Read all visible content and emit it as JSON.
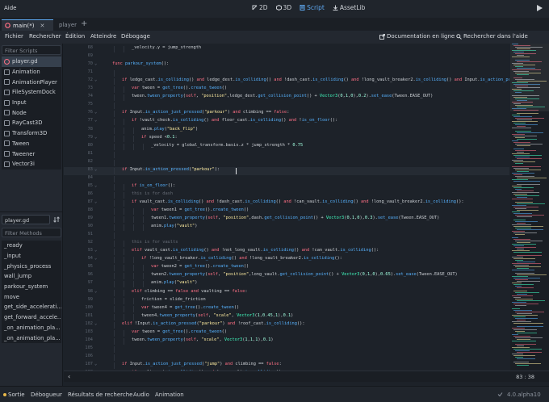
{
  "app": {
    "title": "Aide"
  },
  "modes": [
    {
      "label": "2D"
    },
    {
      "label": "3D"
    },
    {
      "label": "Script",
      "active": true
    },
    {
      "label": "AssetLib"
    }
  ],
  "tabs": {
    "main_label": "main(*)",
    "player_label": "player",
    "add_label": "+"
  },
  "menu": {
    "items": [
      "Fichier",
      "Rechercher",
      "Édition",
      "Atteindre",
      "Débogage"
    ],
    "doc_label": "Documentation en ligne",
    "help_search_label": "Rechercher dans l'aide"
  },
  "left": {
    "filter_scripts_placeholder": "Filter Scripts",
    "scripts": [
      "player.gd",
      "Animation",
      "AnimationPlayer",
      "FileSystemDock",
      "Input",
      "Node",
      "RayCast3D",
      "Transform3D",
      "Tween",
      "Tweener",
      "Vector3i"
    ],
    "current_script": "player.gd",
    "filter_methods_placeholder": "Filter Methods",
    "methods": [
      "_ready",
      "_input",
      "_physics_process",
      "wall_jump",
      "parkour_system",
      "move",
      "get_side_accelerati...",
      "get_forward_accele...",
      "_on_animation_pla...",
      "_on_animation_pla..."
    ]
  },
  "editor": {
    "cursor_line": 83,
    "lines": [
      {
        "n": "68",
        "fold": "",
        "indent": 2,
        "html": "_velocity.y = jump_strength"
      },
      {
        "n": "69",
        "fold": "",
        "indent": 0,
        "html": ""
      },
      {
        "n": "70",
        "fold": "⌄",
        "indent": 0,
        "html": "<span class='k'>func</span> <span class='f'>parkour_system</span>():"
      },
      {
        "n": "71",
        "fold": "",
        "indent": 1,
        "html": ""
      },
      {
        "n": "72",
        "fold": "⌄",
        "indent": 1,
        "html": "<span class='k'>if</span> ledge_cast.<span class='f'>is_colliding</span>() <span class='k'>and</span> ledge_dest.<span class='f'>is_colliding</span>() <span class='k'>and</span> !dash_cast.<span class='f'>is_colliding</span>() <span class='k'>and</span> !long_vault_breaker2.<span class='f'>is_colliding</span>() <span class='k'>and</span> Input.<span class='f'>is_action_pres</span>"
      },
      {
        "n": "73",
        "fold": "",
        "indent": 2,
        "html": "<span class='k'>var</span> tween = <span class='f'>get_tree</span>().<span class='f'>create_tween</span>()"
      },
      {
        "n": "74",
        "fold": "",
        "indent": 2,
        "html": "tween.<span class='f'>tween_property</span>(<span class='k'>self</span>, <span class='s'>\"position\"</span>,ledge_dest.<span class='f'>get_collision_point</span>() + <span class='t'>Vector3</span>(<span class='n'>0</span>,<span class='n'>1</span>,<span class='n'>0</span>),<span class='n'>0.2</span>).<span class='f'>set_ease</span>(Tween.EASE_OUT)"
      },
      {
        "n": "75",
        "fold": "",
        "indent": 1,
        "html": ""
      },
      {
        "n": "76",
        "fold": "⌄",
        "indent": 1,
        "html": "<span class='k'>if</span> Input.<span class='f'>is_action_just_pressed</span>(<span class='s'>\"parkour\"</span>) <span class='k'>and</span> climbing == <span class='k'>false</span>:"
      },
      {
        "n": "77",
        "fold": "⌄",
        "indent": 2,
        "html": "<span class='k'>if</span> !vault_check.<span class='f'>is_colliding</span>() <span class='k'>and</span> floor_cast.<span class='f'>is_colliding</span>() <span class='k'>and</span> !<span class='f'>is_on_floor</span>():"
      },
      {
        "n": "78",
        "fold": "",
        "indent": 3,
        "html": "anim.<span class='f'>play</span>(<span class='s'>\"back_flip\"</span>)"
      },
      {
        "n": "79",
        "fold": "⌄",
        "indent": 3,
        "html": "<span class='k'>if</span> speed &lt;<span class='n'>0.1</span>:"
      },
      {
        "n": "80",
        "fold": "",
        "indent": 4,
        "html": "_velocity = global_transform.basis.z * jump_strength * <span class='n'>0.75</span>"
      },
      {
        "n": "81",
        "fold": "",
        "indent": 1,
        "html": ""
      },
      {
        "n": "82",
        "fold": "",
        "indent": 1,
        "html": ""
      },
      {
        "n": "83",
        "fold": "⌄",
        "indent": 1,
        "html": "<span class='k'>if</span> Input.<span class='f'>is_action_pressed</span>(<span class='s'>\"parkour\"</span>):"
      },
      {
        "n": "84",
        "fold": "",
        "indent": 1,
        "html": ""
      },
      {
        "n": "85",
        "fold": "⌄",
        "indent": 2,
        "html": "<span class='k'>if</span> <span class='f'>is_on_floor</span>():"
      },
      {
        "n": "86",
        "fold": "",
        "indent": 2,
        "html": "<span class='c'>this is for dash</span>"
      },
      {
        "n": "87",
        "fold": "⌄",
        "indent": 2,
        "html": "<span class='k'>if</span> vault_cast.<span class='f'>is_colliding</span>() <span class='k'>and</span> !dash_cast.<span class='f'>is_colliding</span>() <span class='k'>and</span> !can_vault.<span class='f'>is_colliding</span>() <span class='k'>and</span> !long_vault_breaker2.<span class='f'>is_colliding</span>():"
      },
      {
        "n": "88",
        "fold": "",
        "indent": 4,
        "html": "<span class='k'>var</span> tween1 = <span class='f'>get_tree</span>().<span class='f'>create_tween</span>()"
      },
      {
        "n": "89",
        "fold": "",
        "indent": 4,
        "html": "tween1.<span class='f'>tween_property</span>(<span class='k'>self</span>, <span class='s'>\"position\"</span>,dash.<span class='f'>get_collision_point</span>() + <span class='t'>Vector3</span>(<span class='n'>0</span>,<span class='n'>1</span>,<span class='n'>0</span>),<span class='n'>0.3</span>).<span class='f'>set_ease</span>(Tween.EASE_OUT)"
      },
      {
        "n": "90",
        "fold": "",
        "indent": 4,
        "html": "anim.<span class='f'>play</span>(<span class='s'>\"vault\"</span>)"
      },
      {
        "n": "91",
        "fold": "",
        "indent": 1,
        "html": ""
      },
      {
        "n": "92",
        "fold": "",
        "indent": 2,
        "html": "<span class='c'>this is for vaults</span>"
      },
      {
        "n": "93",
        "fold": "⌄",
        "indent": 2,
        "html": "<span class='k'>elif</span> vault_cast.<span class='f'>is_colliding</span>() <span class='k'>and</span> !not_long_vault.<span class='f'>is_colliding</span>() <span class='k'>and</span> !can_vault.<span class='f'>is_colliding</span>():"
      },
      {
        "n": "94",
        "fold": "⌄",
        "indent": 3,
        "html": "<span class='k'>if</span> !long_vault_breaker.<span class='f'>is_colliding</span>() <span class='k'>and</span> !long_vault_breaker2.<span class='f'>is_colliding</span>():"
      },
      {
        "n": "95",
        "fold": "",
        "indent": 4,
        "html": "<span class='k'>var</span> tween2 = <span class='f'>get_tree</span>().<span class='f'>create_tween</span>()"
      },
      {
        "n": "96",
        "fold": "",
        "indent": 4,
        "html": "tween2.<span class='f'>tween_property</span>(<span class='k'>self</span>, <span class='s'>\"position\"</span>,long_vault.<span class='f'>get_collision_point</span>() + <span class='t'>Vector3</span>(<span class='n'>0</span>,<span class='n'>1</span>,<span class='n'>0</span>),<span class='n'>0.65</span>).<span class='f'>set_ease</span>(Tween.EASE_OUT)"
      },
      {
        "n": "97",
        "fold": "",
        "indent": 4,
        "html": "anim.<span class='f'>play</span>(<span class='s'>\"vault\"</span>)"
      },
      {
        "n": "98",
        "fold": "⌄",
        "indent": 2,
        "html": "<span class='k'>elif</span> climbing == <span class='k'>false</span> <span class='k'>and</span> vaulting == <span class='k'>false</span>:"
      },
      {
        "n": "99",
        "fold": "",
        "indent": 3,
        "html": "friction = slide_friction"
      },
      {
        "n": "100",
        "fold": "",
        "indent": 3,
        "html": "<span class='k'>var</span> tween4 = <span class='f'>get_tree</span>().<span class='f'>create_tween</span>()"
      },
      {
        "n": "101",
        "fold": "",
        "indent": 3,
        "html": "tween4.<span class='f'>tween_property</span>(<span class='k'>self</span>, <span class='s'>\"scale\"</span>, <span class='t'>Vector3</span>(<span class='n'>1</span>,<span class='n'>0.45</span>,<span class='n'>1</span>),<span class='n'>0.1</span>)"
      },
      {
        "n": "102",
        "fold": "⌄",
        "indent": 1,
        "html": "<span class='k'>elif</span> !Input.<span class='f'>is_action_pressed</span>(<span class='s'>\"parkour\"</span>) <span class='k'>and</span> !roof_cast.<span class='f'>is_colliding</span>():"
      },
      {
        "n": "103",
        "fold": "",
        "indent": 2,
        "html": "<span class='k'>var</span> tween = <span class='f'>get_tree</span>().<span class='f'>create_tween</span>()"
      },
      {
        "n": "104",
        "fold": "",
        "indent": 2,
        "html": "tween.<span class='f'>tween_property</span>(<span class='k'>self</span>, <span class='s'>\"scale\"</span>, <span class='t'>Vector3</span>(<span class='n'>1</span>,<span class='n'>1</span>,<span class='n'>1</span>),<span class='n'>0.1</span>)"
      },
      {
        "n": "105",
        "fold": "",
        "indent": 1,
        "html": ""
      },
      {
        "n": "106",
        "fold": "",
        "indent": 1,
        "html": ""
      },
      {
        "n": "107",
        "fold": "⌄",
        "indent": 1,
        "html": "<span class='k'>if</span> Input.<span class='f'>is_action_just_pressed</span>(<span class='s'>\"jump\"</span>) <span class='k'>and</span> climbing == <span class='k'>false</span>:"
      },
      {
        "n": "108",
        "fold": "",
        "indent": 2,
        "html": "<span class='k'>if</span> vault_cast.<span class='f'>is_colliding</span>() <span class='k'>and</span> !can_vault.<span class='f'>is_colliding</span>():"
      }
    ]
  },
  "status": {
    "position": "83 :  38"
  },
  "bottom": {
    "items": [
      "Sortie",
      "Débogueur",
      "Résultats de recherche",
      "Audio",
      "Animation"
    ],
    "version": "4.0.alpha10"
  },
  "colors": {
    "accent": "#5ea8f0",
    "keyword": "#ff7085",
    "function": "#57b3ff",
    "string": "#ffeda1"
  }
}
